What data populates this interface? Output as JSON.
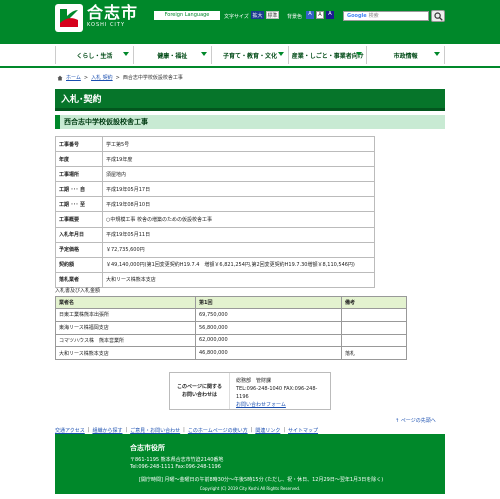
{
  "header": {
    "logo_jp": "合志市",
    "logo_en": "KOSHI CITY",
    "foreign_language": "Foreign Language",
    "text_size_label": "文字サイズ",
    "text_size_large": "拡大",
    "text_size_standard": "標準",
    "bg_color_label": "背景色",
    "bg_color_buttons": [
      "A",
      "A",
      "A"
    ],
    "search_brand": "Google",
    "search_hint": "検索"
  },
  "nav": {
    "items": [
      {
        "label": "くらし・生活"
      },
      {
        "label": "健康・福祉"
      },
      {
        "label": "子育て・教育・文化"
      },
      {
        "label": "産業・しごと・事業者向け"
      },
      {
        "label": "市政情報"
      }
    ]
  },
  "breadcrumb": {
    "home": "ホーム",
    "sep": ">",
    "level1": "入札 契約",
    "current": "西合志中学校仮設校舎工事"
  },
  "page": {
    "title": "入札･契約",
    "subtitle": "西合志中学校仮設校舎工事"
  },
  "info_table": {
    "rows": [
      {
        "label": "工事番号",
        "value": "学工第5号"
      },
      {
        "label": "年度",
        "value": "平成19年度"
      },
      {
        "label": "工事場所",
        "value": "須屋地内"
      },
      {
        "label": "工期 ･･･ 自",
        "value": "平成19年05月17日"
      },
      {
        "label": "工期 ･･･ 至",
        "value": "平成19年08月10日"
      },
      {
        "label": "工事概要",
        "value": "○中規模工事 校舎の増築のための仮設校舎工事"
      },
      {
        "label": "入札年月日",
        "value": "平成19年05月11日"
      },
      {
        "label": "予定価格",
        "value": "￥72,735,600円"
      },
      {
        "label": "契約額",
        "value": "￥49,140,000円(第1回変更契約H19.7.4　増額￥6,821,254円,第2回変更契約H19.7.30増額￥8,110,546円)"
      },
      {
        "label": "落札業者",
        "value": "大和リース株熊本支店"
      }
    ]
  },
  "bid": {
    "caption": "入札書及び入札金額",
    "headers": [
      "業者名",
      "第1回",
      "備考"
    ],
    "rows": [
      [
        "日東工業株熊本出張所",
        "69,750,000",
        ""
      ],
      [
        "東海リース株福岡支店",
        "56,800,000",
        ""
      ],
      [
        "コマツハウス株　熊本営業所",
        "62,000,000",
        ""
      ],
      [
        "大和リース株熊本支店",
        "46,800,000",
        "落札"
      ]
    ]
  },
  "contact": {
    "label_line1": "このページに関する",
    "label_line2": "お問い合わせは",
    "dept": "総務部　管財課",
    "tel": "TEL:096-248-1040 FAX:096-248-1196",
    "form_link": "お問い合わせフォーム"
  },
  "to_top": "ページの先頭へ",
  "footer_links": [
    "交通アクセス",
    "組織から探す",
    "ご意見・お問い合わせ",
    "このホームページの使い方",
    "関連リンク",
    "サイトマップ"
  ],
  "footer": {
    "name": "合志市役所",
    "address": "〒861-1195  熊本県合志市竹迫2140番地",
    "tel": "Tel:096-248-1111   Fax:096-248-1196",
    "hours": "[開庁時間] 月曜～金曜日の午前8時30分～午後5時15分 (ただし、祝・休日、12月29日～翌年1月3日を除く)",
    "copyright": "Copyright (C) 2019 City Koshi All Rights Reserved."
  },
  "colors": {
    "brand_green": "#00882a",
    "title_green": "#06752a",
    "subtitle_bg": "#c8ead3",
    "table_header_bg": "#e3f2cf",
    "link_blue": "#1a4fb0"
  }
}
